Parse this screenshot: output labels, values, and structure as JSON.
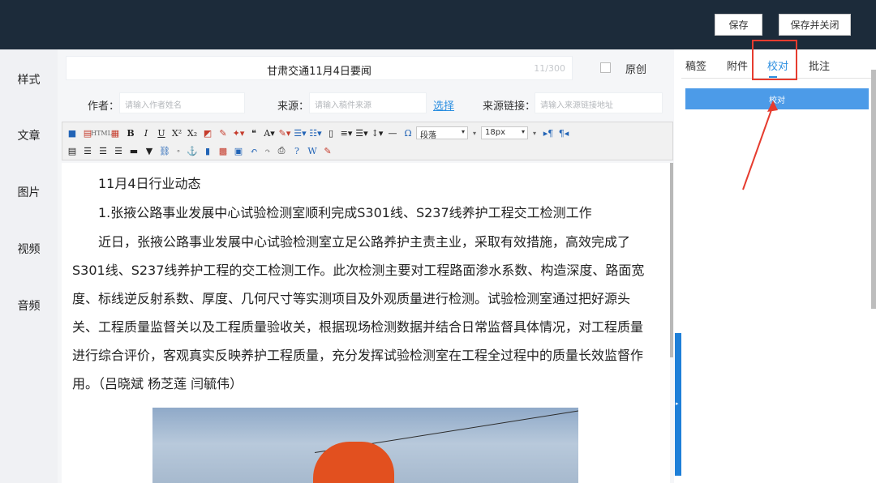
{
  "topbar": {
    "save_label": "保存",
    "save_close_label": "保存并关闭"
  },
  "leftnav": {
    "items": [
      "样式",
      "文章",
      "图片",
      "视频",
      "音频"
    ]
  },
  "editor": {
    "title": "甘肃交通11月4日要闻",
    "title_count": "11/300",
    "original_label": "原创",
    "author_label": "作者：",
    "author_placeholder": "请输入作者姓名",
    "source_label": "来源：",
    "source_placeholder": "请输入稿件来源",
    "choose_label": "选择",
    "source_link_label": "来源链接：",
    "source_link_placeholder": "请输入来源链接地址",
    "toolbar": {
      "paragraph_select": "段落",
      "size_select": "18px"
    },
    "paragraphs": [
      "11月4日行业动态",
      "1.张掖公路事业发展中心试验检测室顺利完成S301线、S237线养护工程交工检测工作",
      "近日，张掖公路事业发展中心试验检测室立足公路养护主责主业，采取有效措施，高效完成了S301线、S237线养护工程的交工检测工作。此次检测主要对工程路面渗水系数、构造深度、路面宽度、标线逆反射系数、厚度、几何尺寸等实测项目及外观质量进行检测。试验检测室通过把好源头关、工程质量监督关以及工程质量验收关，根据现场检测数据并结合日常监督具体情况，对工程质量进行综合评价，客观真实反映养护工程质量，充分发挥试验检测室在工程全过程中的质量长效监督作用。（吕晓斌 杨芝莲 闫毓伟）"
    ]
  },
  "rightpanel": {
    "tabs": [
      "稿签",
      "附件",
      "校对",
      "批注"
    ],
    "active_tab": "校对",
    "proof_button_label": "校对"
  },
  "colors": {
    "topbar": "#1c2b3a",
    "accent": "#2a8ee0",
    "highlight": "#e63c2f"
  }
}
